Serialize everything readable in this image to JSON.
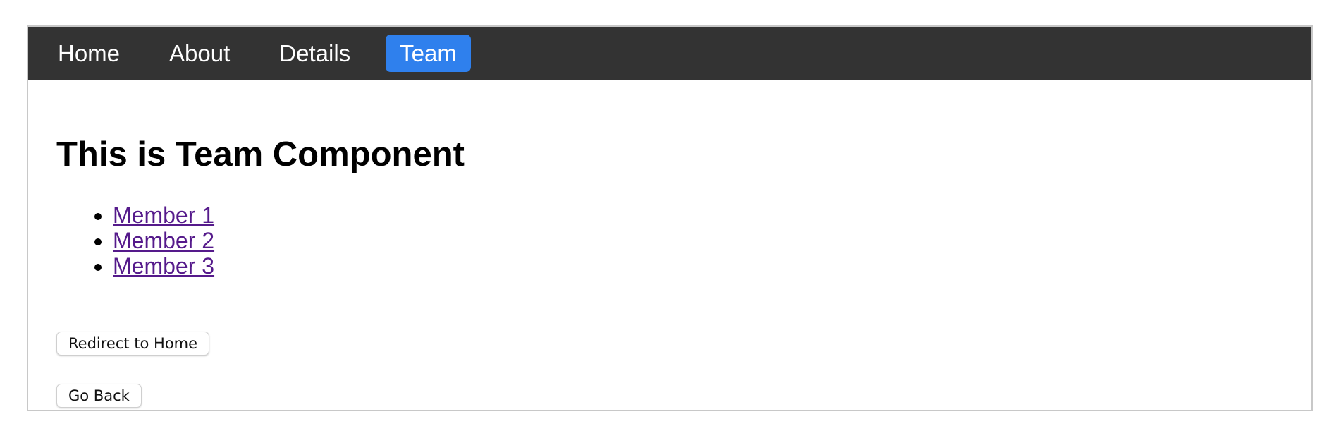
{
  "nav": {
    "items": [
      {
        "label": "Home",
        "active": false
      },
      {
        "label": "About",
        "active": false
      },
      {
        "label": "Details",
        "active": false
      },
      {
        "label": "Team",
        "active": true
      }
    ],
    "background_color": "#333333",
    "active_color": "#2f80ed"
  },
  "main": {
    "heading": "This is Team Component",
    "members": [
      {
        "label": "Member 1"
      },
      {
        "label": "Member 2"
      },
      {
        "label": "Member 3"
      }
    ],
    "redirect_button_label": "Redirect to Home",
    "back_button_label": "Go Back"
  }
}
